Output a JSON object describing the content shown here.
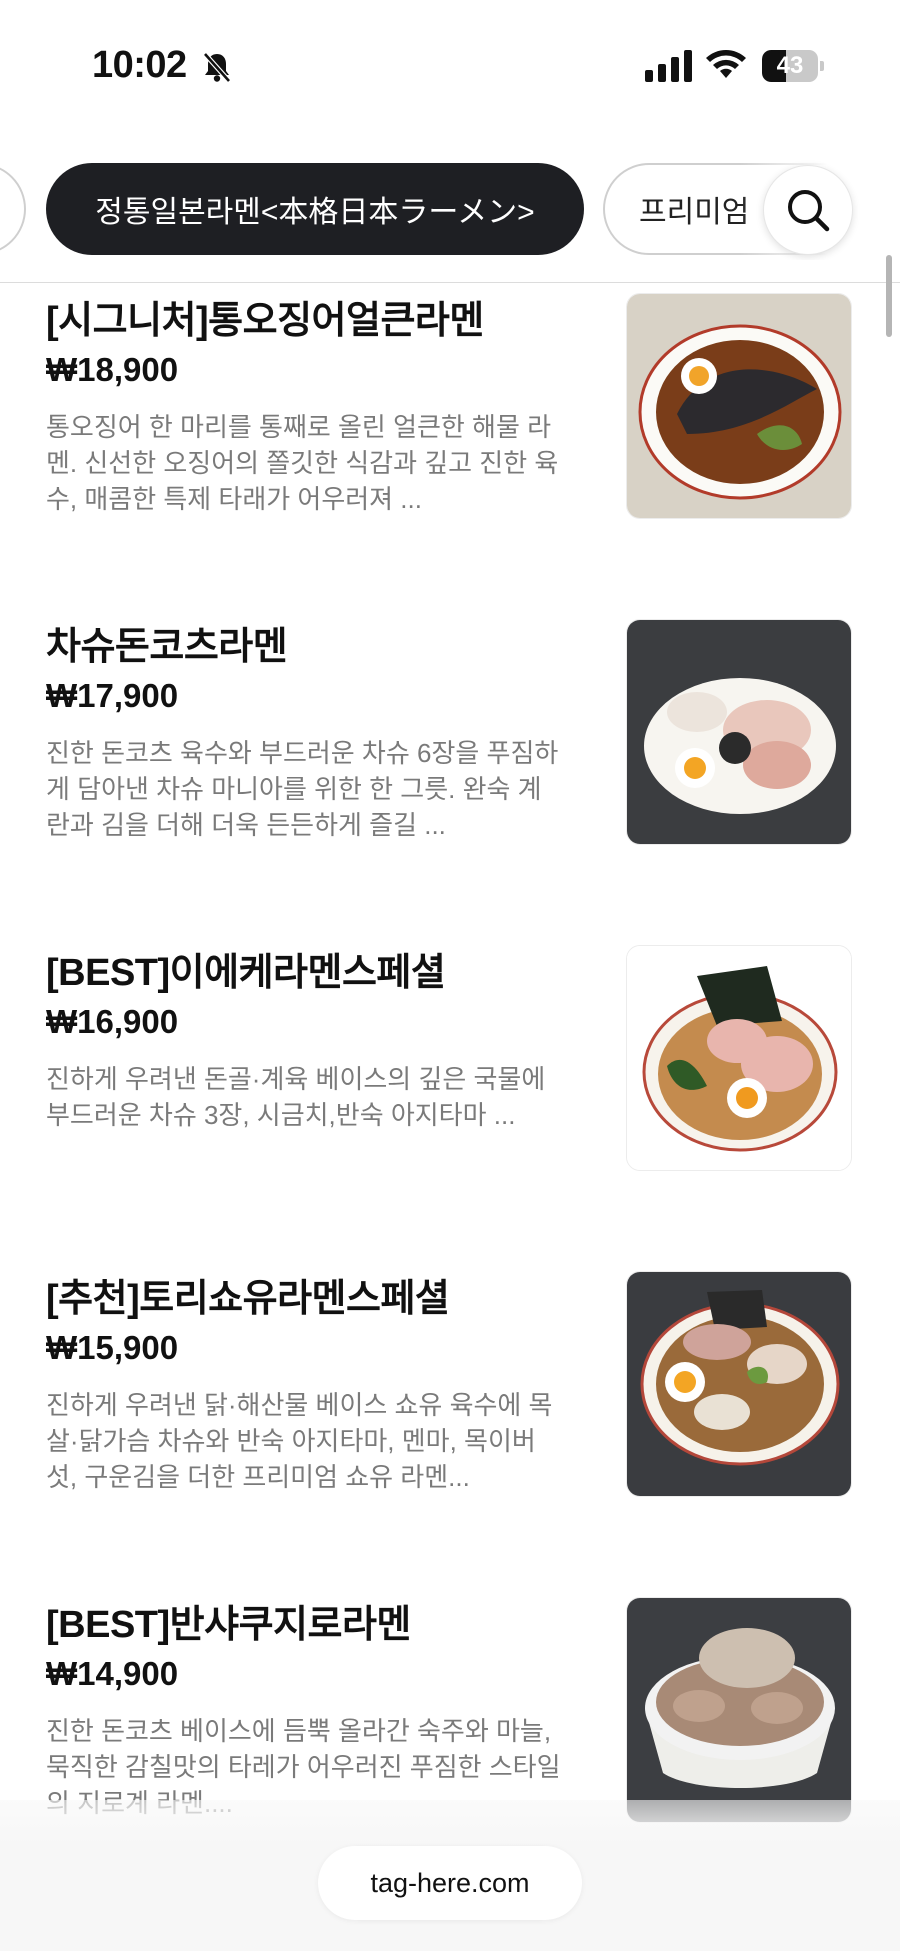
{
  "status_bar": {
    "time": "10:02",
    "battery_level": "43",
    "battery_fraction": 0.43,
    "icons": [
      "bell-slash-icon",
      "signal-icon",
      "wifi-icon",
      "battery-icon"
    ]
  },
  "categories": {
    "active": "정통일본라멘<本格日本ラーメン>",
    "next": "프리미엄",
    "search_icon": "search-icon"
  },
  "menu": [
    {
      "name": "[시그니처]통오징어얼큰라멘",
      "price": "₩18,900",
      "description": "통오징어 한 마리를 통째로 올린 얼큰한 해물 라멘. 신선한 오징어의 쫄깃한 식감과 깊고 진한 육수, 매콤한 특제 타래가 어우러져 ...",
      "thumb_colors": [
        "#d8d2c6",
        "#7a3d19",
        "#2c2a2e"
      ]
    },
    {
      "name": "차슈돈코츠라멘",
      "price": "₩17,900",
      "description": "진한 돈코츠 육수와 부드러운 차슈 6장을 푸짐하게 담아낸 차슈 마니아를 위한 한 그릇. 완숙 계란과 김을 더해 더욱 든든하게 즐길 ...",
      "thumb_colors": [
        "#3b3d40",
        "#e9c7bc",
        "#2b2b2b"
      ]
    },
    {
      "name": "[BEST]이에케라멘스페셜",
      "price": "₩16,900",
      "description": "진하게 우려낸 돈골·계육 베이스의 깊은 국물에\n부드러운 차슈 3장, 시금치,반숙 아지타마 ...",
      "thumb_colors": [
        "#ffffff",
        "#c48b4e",
        "#1f2a1f"
      ]
    },
    {
      "name": "[추천]토리쇼유라멘스페셜",
      "price": "₩15,900",
      "description": "진하게 우려낸 닭·해산물 베이스 쇼유 육수에 목살·닭가슴 차슈와 반숙 아지타마, 멘마, 목이버섯, 구운김을 더한 프리미엄 쇼유 라멘...",
      "thumb_colors": [
        "#3a3c40",
        "#9a6a3a",
        "#2a2a2a"
      ]
    },
    {
      "name": "[BEST]반샤쿠지로라멘",
      "price": "₩14,900",
      "description": "진한 돈코츠 베이스에 듬뿍 올라간 숙주와 마늘, 묵직한 감칠맛의 타레가 어우러진 푸짐한 스타일의 지로계 라멘....",
      "thumb_colors": [
        "#3c3e42",
        "#cdbfb0",
        "#f2f2f2"
      ]
    }
  ],
  "footer": {
    "url": "tag-here.com"
  }
}
